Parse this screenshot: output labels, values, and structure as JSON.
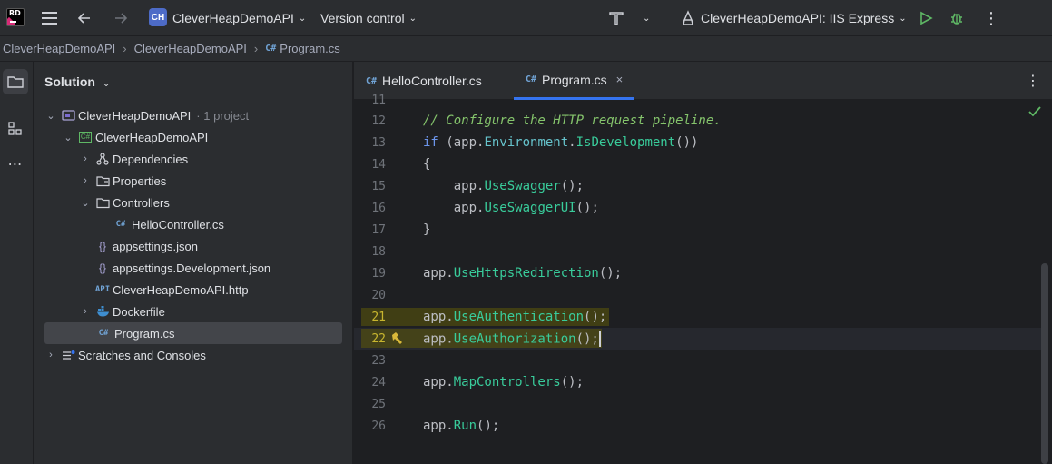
{
  "titlebar": {
    "project_badge": "CH",
    "project_name": "CleverHeapDemoAPI",
    "version_control": "Version control",
    "run_config": "CleverHeapDemoAPI: IIS Express"
  },
  "breadcrumb": {
    "items": [
      "CleverHeapDemoAPI",
      "CleverHeapDemoAPI",
      "Program.cs"
    ],
    "file_prefix": "C#"
  },
  "panel": {
    "title": "Solution",
    "tree": [
      {
        "label": "CleverHeapDemoAPI",
        "extra": "· 1 project"
      },
      {
        "label": "CleverHeapDemoAPI"
      },
      {
        "label": "Dependencies"
      },
      {
        "label": "Properties"
      },
      {
        "label": "Controllers"
      },
      {
        "label": "HelloController.cs"
      },
      {
        "label": "appsettings.json"
      },
      {
        "label": "appsettings.Development.json"
      },
      {
        "label": "CleverHeapDemoAPI.http"
      },
      {
        "label": "Dockerfile"
      },
      {
        "label": "Program.cs"
      },
      {
        "label": "Scratches and Consoles"
      }
    ]
  },
  "editor": {
    "tabs": [
      {
        "prefix": "C#",
        "label": "HelloController.cs"
      },
      {
        "prefix": "C#",
        "label": "Program.cs"
      }
    ],
    "line_numbers": [
      "11",
      "12",
      "13",
      "14",
      "15",
      "16",
      "17",
      "18",
      "19",
      "20",
      "21",
      "22",
      "23",
      "24",
      "25",
      "26"
    ],
    "code": {
      "l12": "// Configure the HTTP request pipeline.",
      "l13_kw": "if",
      "l13_a": " (app.",
      "l13_prop": "Environment",
      "l13_b": ".",
      "l13_m": "IsDevelopment",
      "l13_c": "())",
      "l14": "{",
      "l15_a": "    app.",
      "l15_m": "UseSwagger",
      "l15_b": "();",
      "l16_a": "    app.",
      "l16_m": "UseSwaggerUI",
      "l16_b": "();",
      "l17": "}",
      "l19_a": "app.",
      "l19_m": "UseHttpsRedirection",
      "l19_b": "();",
      "l21_a": "app.",
      "l21_m": "UseAuthentication",
      "l21_b": "();",
      "l22_a": "app.",
      "l22_m": "UseAuthorization",
      "l22_b": "();",
      "l24_a": "app.",
      "l24_m": "MapControllers",
      "l24_b": "();",
      "l26_a": "app.",
      "l26_m": "Run",
      "l26_b": "();"
    }
  },
  "colors": {
    "accent": "#3574f0",
    "keyword": "#6c95eb",
    "comment": "#85c46c",
    "method": "#39cc9b",
    "run_green": "#5fb865"
  }
}
